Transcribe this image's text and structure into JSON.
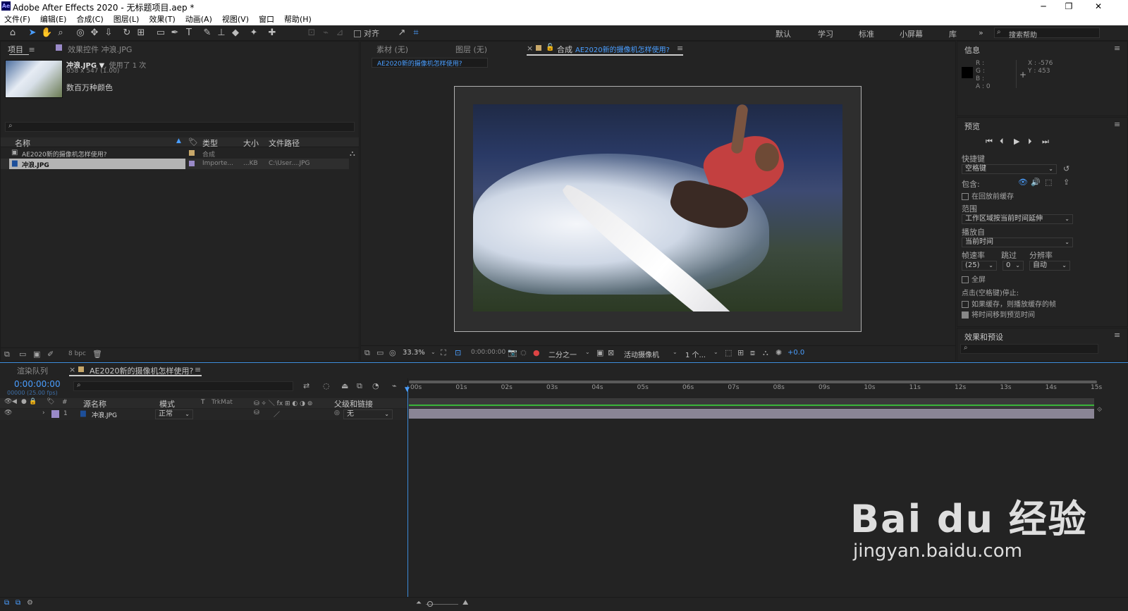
{
  "window": {
    "title": "Adobe After Effects 2020 - 无标题项目.aep *",
    "logo": "Ae"
  },
  "menu": [
    "文件(F)",
    "编辑(E)",
    "合成(C)",
    "图层(L)",
    "效果(T)",
    "动画(A)",
    "视图(V)",
    "窗口",
    "帮助(H)"
  ],
  "toolbar": {
    "align_label": "对齐",
    "workspaces": [
      "默认",
      "学习",
      "标准",
      "小屏幕",
      "库"
    ],
    "more": "»",
    "search_placeholder": "搜索帮助"
  },
  "project": {
    "tab_project": "项目",
    "tab_effects": "效果控件 冲浪.JPG",
    "thumb_name": "冲浪.JPG ▼",
    "thumb_used": ", 使用了 1 次",
    "thumb_dims": "858 x 547 (1.00)",
    "thumb_colors": "数百万种颜色",
    "columns": [
      "名称",
      "类型",
      "大小",
      "文件路径"
    ],
    "items": [
      {
        "name": "AE2020新的摄像机怎样使用?",
        "type": "合成",
        "size": "",
        "path": "",
        "color": "#c8a86a"
      },
      {
        "name": "冲浪.JPG",
        "type": "Importe...",
        "size": "...KB",
        "path": "C:\\User....JPG",
        "color": "#9a8ac8"
      }
    ],
    "bpc": "8 bpc"
  },
  "viewer": {
    "tabs": [
      "素材 (无)",
      "图层 (无)"
    ],
    "comp_tab_prefix": "合成",
    "comp_name": "AE2020新的摄像机怎样使用?",
    "comp_chip": "AE2020新的摄像机怎样使用?",
    "zoom": "33.3%",
    "timecode": "0:00:00:00",
    "resolution": "二分之一",
    "camera": "活动摄像机",
    "views": "1 个...",
    "exposure": "+0.0"
  },
  "info": {
    "title": "信息",
    "r": "R :",
    "g": "G :",
    "b": "B :",
    "a": "A : 0",
    "x": "X : -576",
    "y": "Y : 453"
  },
  "preview": {
    "title": "预览",
    "shortcut_label": "快捷键",
    "shortcut_value": "空格键",
    "include_label": "包含:",
    "cache_before": "在回放前缓存",
    "range_label": "范围",
    "range_value": "工作区域按当前时间延伸",
    "play_from_label": "播放自",
    "play_from_value": "当前时间",
    "fps_label": "帧速率",
    "skip_label": "跳过",
    "res_label": "分辨率",
    "fps_value": "(25)",
    "skip_value": "0",
    "res_value": "自动",
    "fullscreen": "全屏",
    "click_stop": "点击(空格键)停止:",
    "if_cache": "如果缓存，则播放缓存的帧",
    "move_time": "将时间移到预览时间"
  },
  "effects": {
    "title": "效果和预设"
  },
  "timeline": {
    "tab_render": "渲染队列",
    "tab_comp": "AE2020新的摄像机怎样使用?",
    "timecode": "0:00:00:00",
    "fps_info": "00000 (25.00 fps)",
    "columns": {
      "num": "#",
      "source": "源名称",
      "mode": "模式",
      "t": "T",
      "trkmat": "TrkMat",
      "parent": "父级和链接"
    },
    "layer": {
      "num": "1",
      "name": "冲浪.JPG",
      "mode": "正常",
      "parent": "无"
    },
    "ruler": [
      "00s",
      "01s",
      "02s",
      "03s",
      "04s",
      "05s",
      "06s",
      "07s",
      "08s",
      "09s",
      "10s",
      "11s",
      "12s",
      "13s",
      "14s",
      "15s"
    ]
  },
  "watermark": {
    "brand": "Bai du 经验",
    "url": "jingyan.baidu.com"
  },
  "colors": {
    "accent": "#4a9eff",
    "label_purple": "#9a8ac8",
    "label_tan": "#c8a86a",
    "track_green": "#3ab53a"
  }
}
